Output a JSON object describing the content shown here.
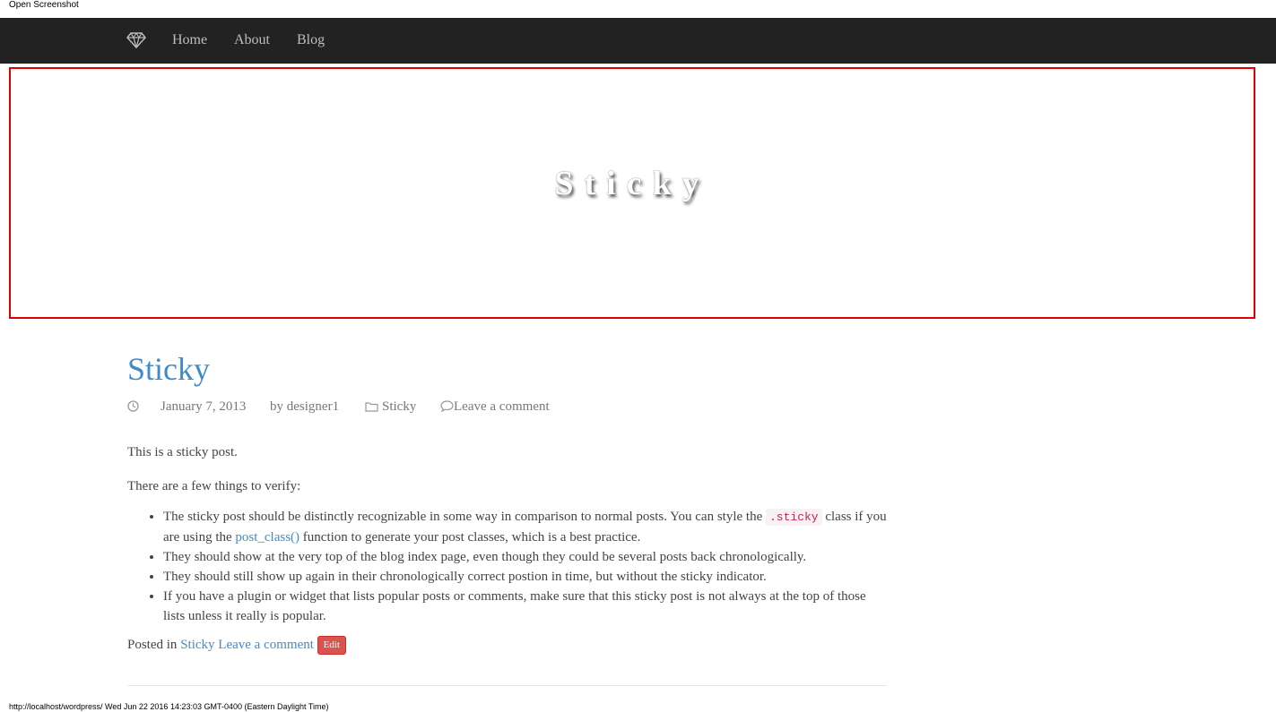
{
  "screenshot_label": "Open Screenshot",
  "nav": {
    "logo_icon": "diamond-icon",
    "items": [
      {
        "label": "Home"
      },
      {
        "label": "About"
      },
      {
        "label": "Blog"
      }
    ]
  },
  "hero": {
    "title": "Sticky",
    "border_color": "#e00000"
  },
  "post": {
    "title": "Sticky",
    "meta": {
      "clock_icon": "clock-icon",
      "date": "January 7, 2013",
      "author": "by designer1",
      "folder_icon": "folder-icon",
      "category": "Sticky",
      "comment_icon": "comment-icon",
      "comment_link": "Leave a comment"
    },
    "paragraph1": "This is a sticky post.",
    "paragraph2": "There are a few things to verify:",
    "bullets": {
      "item1_pre": "The sticky post should be distinctly recognizable in some way in comparison to normal posts. You can style the ",
      "item1_code": ".sticky",
      "item1_mid": " class if you are using the ",
      "item1_link": "post_class()",
      "item1_post": " function to generate your post classes, which is a best practice.",
      "item2": "They should show at the very top of the blog index page, even though they could be several posts back chronologically.",
      "item3": "They should still show up again in their chronologically correct postion in time, but without the sticky indicator.",
      "item4": "If you have a plugin or widget that lists popular posts or comments, make sure that this sticky post is not always at the top of those lists unless it really is popular."
    },
    "footer": {
      "posted_in": "Posted in",
      "category_link": "Sticky",
      "comment_link": "Leave a comment",
      "edit_label": "Edit"
    }
  },
  "status_bar": "http://localhost/wordpress/ Wed Jun 22 2016 14:23:03 GMT-0400 (Eastern Daylight Time)",
  "colors": {
    "navbar_bg": "#222222",
    "link": "#428bca",
    "edit_button": "#d9534f"
  }
}
